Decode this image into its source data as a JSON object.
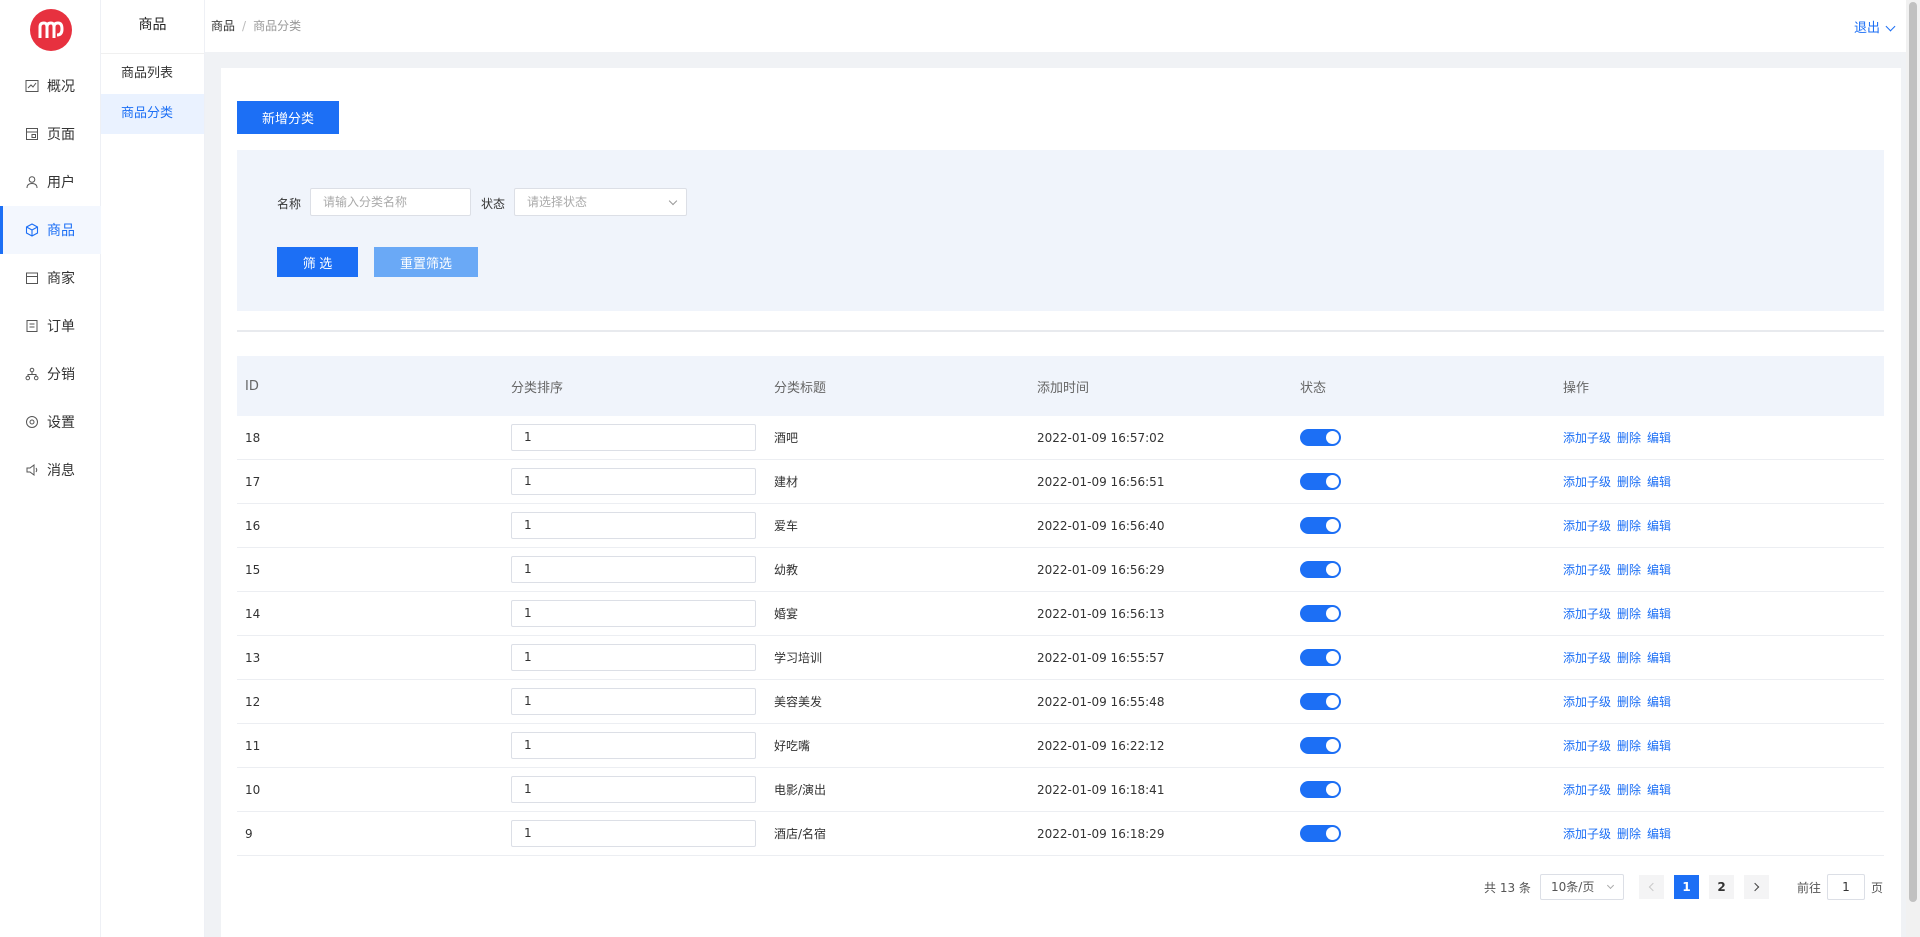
{
  "nav": {
    "logo_text": "mp",
    "items": [
      {
        "label": "概况",
        "icon": "chart-icon"
      },
      {
        "label": "页面",
        "icon": "page-icon"
      },
      {
        "label": "用户",
        "icon": "user-icon"
      },
      {
        "label": "商品",
        "icon": "cube-icon",
        "active": true
      },
      {
        "label": "商家",
        "icon": "store-icon"
      },
      {
        "label": "订单",
        "icon": "order-icon"
      },
      {
        "label": "分销",
        "icon": "distribution-icon"
      },
      {
        "label": "设置",
        "icon": "settings-icon"
      },
      {
        "label": "消息",
        "icon": "speaker-icon"
      }
    ]
  },
  "subnav": {
    "title": "商品",
    "items": [
      {
        "label": "商品列表"
      },
      {
        "label": "商品分类",
        "active": true
      }
    ]
  },
  "header": {
    "breadcrumb": {
      "root": "商品",
      "sep": "/",
      "current": "商品分类"
    },
    "logout": "退出"
  },
  "toolbar": {
    "add_label": "新增分类"
  },
  "filter": {
    "name_label": "名称",
    "name_placeholder": "请输入分类名称",
    "status_label": "状态",
    "status_placeholder": "请选择状态",
    "filter_button": "筛 选",
    "reset_button": "重置筛选"
  },
  "table": {
    "headers": [
      "ID",
      "分类排序",
      "分类标题",
      "添加时间",
      "状态",
      "操作"
    ],
    "actions": [
      "添加子级",
      "删除",
      "编辑"
    ],
    "rows": [
      {
        "id": "18",
        "sort": "1",
        "title": "酒吧",
        "time": "2022-01-09 16:57:02",
        "status": true
      },
      {
        "id": "17",
        "sort": "1",
        "title": "建材",
        "time": "2022-01-09 16:56:51",
        "status": true
      },
      {
        "id": "16",
        "sort": "1",
        "title": "爱车",
        "time": "2022-01-09 16:56:40",
        "status": true
      },
      {
        "id": "15",
        "sort": "1",
        "title": "幼教",
        "time": "2022-01-09 16:56:29",
        "status": true
      },
      {
        "id": "14",
        "sort": "1",
        "title": "婚宴",
        "time": "2022-01-09 16:56:13",
        "status": true
      },
      {
        "id": "13",
        "sort": "1",
        "title": "学习培训",
        "time": "2022-01-09 16:55:57",
        "status": true
      },
      {
        "id": "12",
        "sort": "1",
        "title": "美容美发",
        "time": "2022-01-09 16:55:48",
        "status": true
      },
      {
        "id": "11",
        "sort": "1",
        "title": "好吃嘴",
        "time": "2022-01-09 16:22:12",
        "status": true
      },
      {
        "id": "10",
        "sort": "1",
        "title": "电影/演出",
        "time": "2022-01-09 16:18:41",
        "status": true
      },
      {
        "id": "9",
        "sort": "1",
        "title": "酒店/名宿",
        "time": "2022-01-09 16:18:29",
        "status": true
      }
    ]
  },
  "pagination": {
    "total_text": "共 13 条",
    "page_size": "10条/页",
    "pages": [
      "1",
      "2"
    ],
    "current_page": "1",
    "goto_prefix": "前往",
    "goto_value": "1",
    "goto_suffix": "页"
  },
  "colors": {
    "accent": "#1c6ff5",
    "logo": "#e7313f",
    "reset_button": "#6aa9f6"
  }
}
